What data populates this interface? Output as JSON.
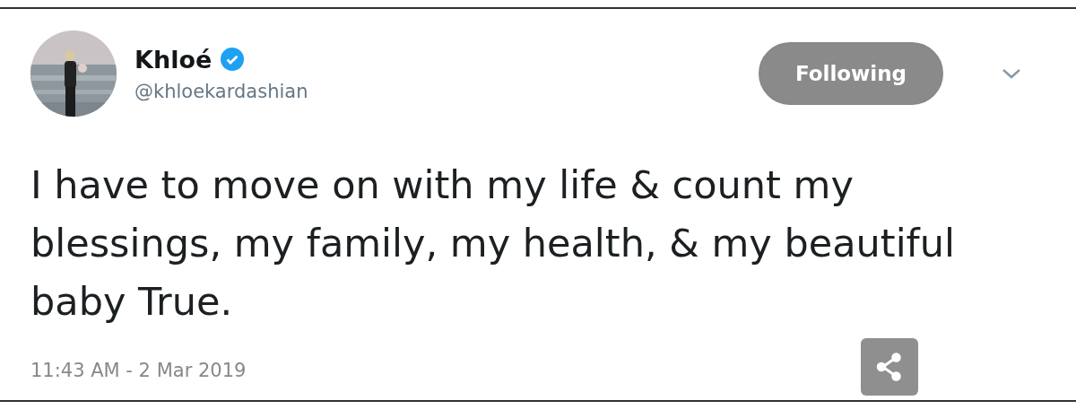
{
  "author": {
    "name": "Khloé",
    "verified": true,
    "handle": "@khloekardashian"
  },
  "follow_button": {
    "label": "Following",
    "selected": true
  },
  "tweet": {
    "text": "I have to move on with my life & count my blessings, my family, my health, & my beautiful baby True.",
    "timestamp": "11:43 AM - 2 Mar 2019"
  }
}
